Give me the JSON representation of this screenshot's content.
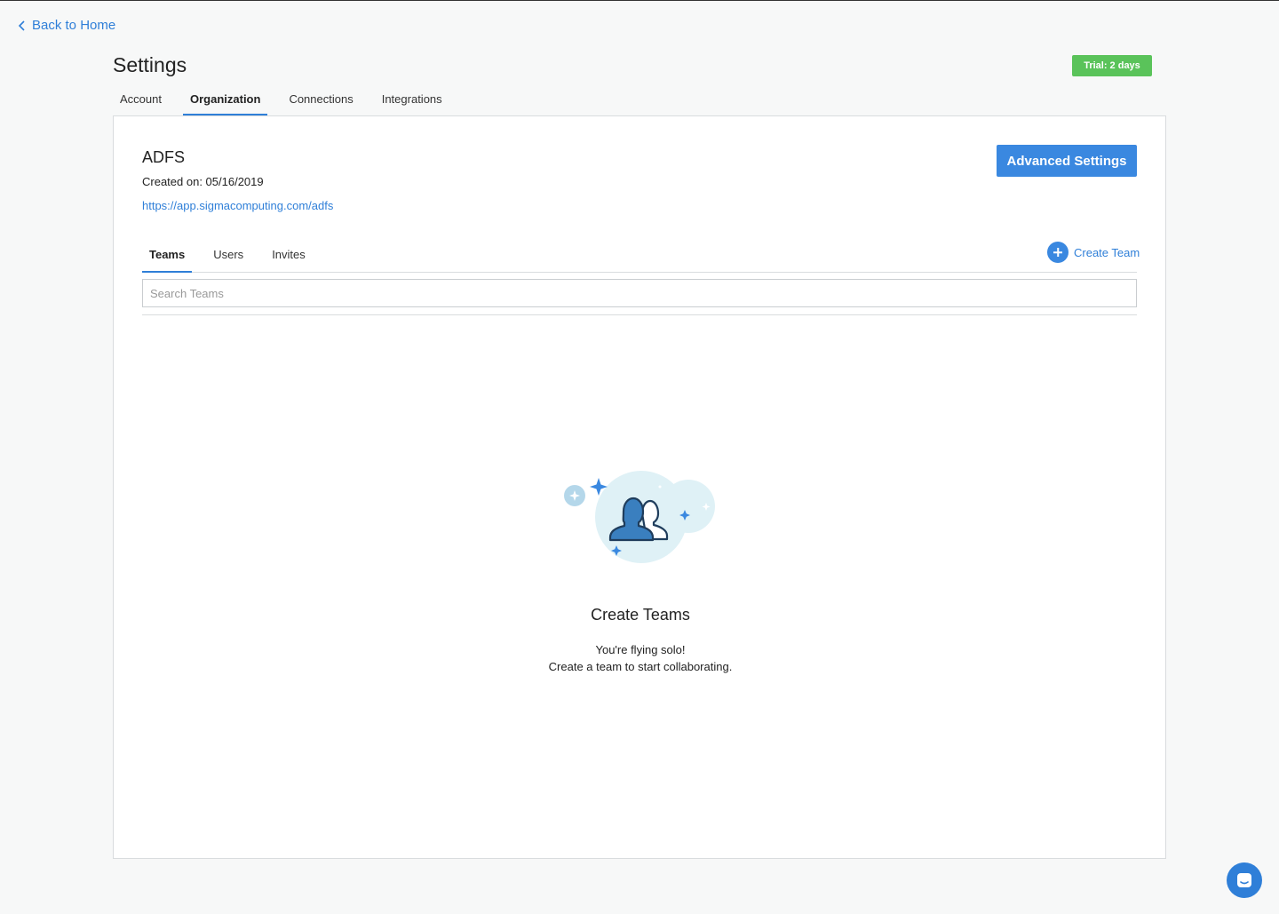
{
  "nav": {
    "back_label": "Back to Home"
  },
  "header": {
    "title": "Settings",
    "trial_badge": "Trial: 2 days"
  },
  "main_tabs": [
    {
      "label": "Account",
      "active": false
    },
    {
      "label": "Organization",
      "active": true
    },
    {
      "label": "Connections",
      "active": false
    },
    {
      "label": "Integrations",
      "active": false
    }
  ],
  "org": {
    "name": "ADFS",
    "created": "Created on: 05/16/2019",
    "url": "https://app.sigmacomputing.com/adfs",
    "advanced_settings_label": "Advanced Settings"
  },
  "sub_tabs": [
    {
      "label": "Teams",
      "active": true
    },
    {
      "label": "Users",
      "active": false
    },
    {
      "label": "Invites",
      "active": false
    }
  ],
  "teams": {
    "create_label": "Create Team",
    "search_placeholder": "Search Teams",
    "search_value": "",
    "empty": {
      "title": "Create Teams",
      "line1": "You're flying solo!",
      "line2": "Create a team to start collaborating."
    }
  },
  "icons": {
    "back": "chevron-left-icon",
    "create": "plus-circle-icon",
    "illustration": "team-people-icon",
    "chat": "chat-icon"
  },
  "colors": {
    "accent": "#2f7fd8",
    "button": "#3a88e0",
    "trial": "#5ac35a",
    "illustration_light": "#dff1f6",
    "illustration_person": "#3a7fbf"
  }
}
